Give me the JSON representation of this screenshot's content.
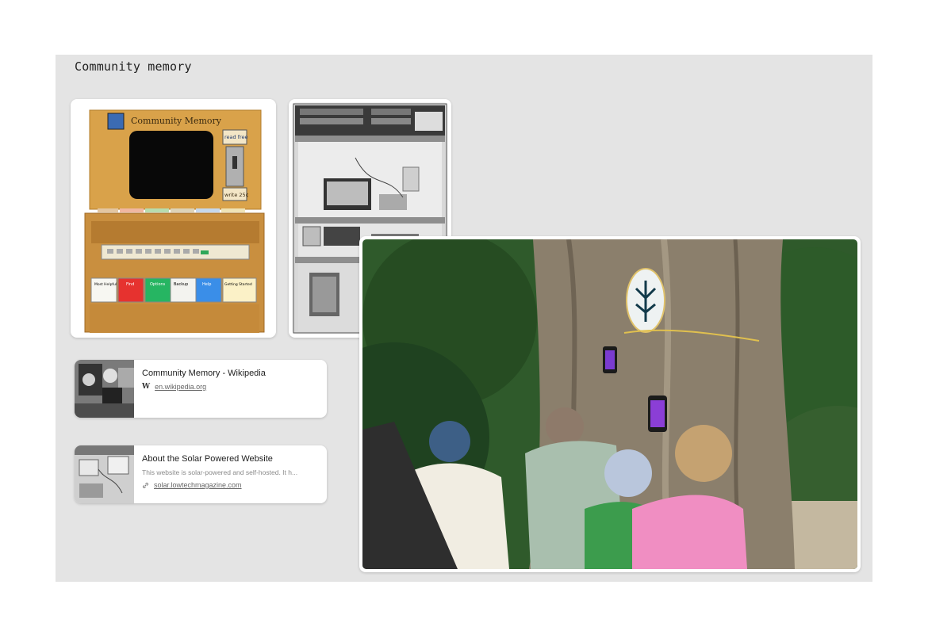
{
  "board": {
    "title": "Community memory"
  },
  "images": {
    "terminal": {
      "header": "Community Memory",
      "slot_labels": [
        "read free",
        "write 25¢"
      ],
      "key_labels": [
        "Most Helpful",
        "Find",
        "Options",
        "Backup",
        "Help",
        "Getting Started"
      ]
    },
    "shelf": {
      "icon": "shelf-photo-icon"
    },
    "tree": {
      "icon": "tree-photo-icon"
    }
  },
  "links": [
    {
      "title": "Community Memory - Wikipedia",
      "description": "",
      "url": "en.wikipedia.org",
      "favicon": "wikipedia-icon",
      "favicon_text": "W"
    },
    {
      "title": "About the Solar Powered Website",
      "description": "This website is solar-powered and self-hosted. It h...",
      "url": "solar.lowtechmagazine.com",
      "favicon": "link-icon"
    }
  ],
  "colors": {
    "board_bg": "#e4e4e4",
    "card_bg": "#ffffff",
    "terminal_wood": "#d9a24a"
  }
}
